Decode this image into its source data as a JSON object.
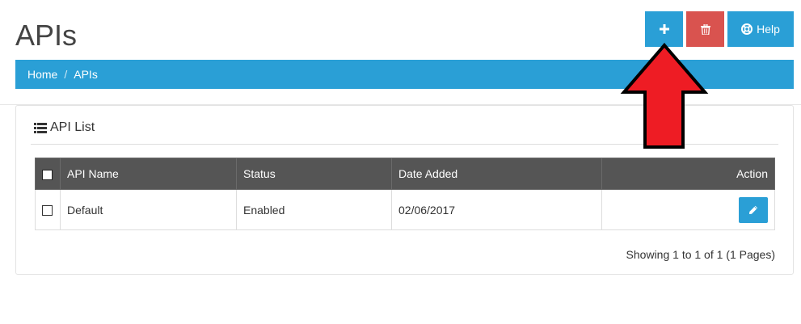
{
  "header": {
    "title": "APIs"
  },
  "toolbar": {
    "add_label": "",
    "delete_label": "",
    "help_label": "Help"
  },
  "breadcrumb": {
    "items": [
      "Home",
      "APIs"
    ],
    "separator": "/"
  },
  "panel": {
    "heading": "API List"
  },
  "table": {
    "columns": [
      "API Name",
      "Status",
      "Date Added",
      "Action"
    ],
    "rows": [
      {
        "name": "Default",
        "status": "Enabled",
        "date_added": "02/06/2017"
      }
    ]
  },
  "pagination": {
    "text": "Showing 1 to 1 of 1 (1 Pages)"
  },
  "colors": {
    "primary": "#2a9fd6",
    "danger": "#d9534f",
    "table_header": "#555555",
    "annotation_arrow": "#ee1c24"
  },
  "icons": {
    "add": "plus-icon",
    "delete": "trash-icon",
    "help": "life-ring-icon",
    "list": "list-icon",
    "edit": "pencil-icon"
  }
}
